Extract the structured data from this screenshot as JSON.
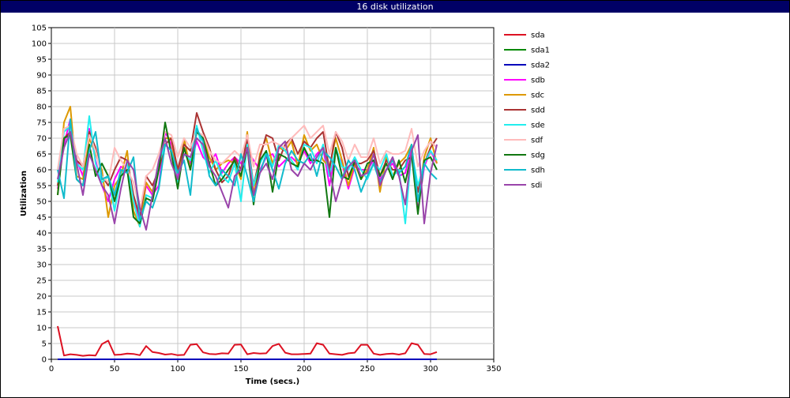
{
  "window": {
    "title": "16 disk utilization"
  },
  "chart_data": {
    "type": "line",
    "title": "16 disk utilization",
    "xlabel": "Time (secs.)",
    "ylabel": "Utilization",
    "xlim": [
      0,
      350
    ],
    "ylim": [
      0,
      105
    ],
    "xticks": [
      0,
      50,
      100,
      150,
      200,
      250,
      300,
      350
    ],
    "yticks": [
      0,
      5,
      10,
      15,
      20,
      25,
      30,
      35,
      40,
      45,
      50,
      55,
      60,
      65,
      70,
      75,
      80,
      85,
      90,
      95,
      100,
      105
    ],
    "grid": true,
    "legend_position": "right",
    "x": [
      5,
      10,
      15,
      20,
      25,
      30,
      35,
      40,
      45,
      50,
      55,
      60,
      65,
      70,
      75,
      80,
      85,
      90,
      95,
      100,
      105,
      110,
      115,
      120,
      125,
      130,
      135,
      140,
      145,
      150,
      155,
      160,
      165,
      170,
      175,
      180,
      185,
      190,
      195,
      200,
      205,
      210,
      215,
      220,
      225,
      230,
      235,
      240,
      245,
      250,
      255,
      260,
      265,
      270,
      275,
      280,
      285,
      290,
      295,
      300,
      305
    ],
    "series": [
      {
        "name": "sda",
        "color": "#dd1122",
        "values": [
          10.5,
          1.2,
          1.6,
          1.4,
          1.1,
          1.3,
          1.2,
          4.8,
          5.9,
          1.4,
          1.5,
          1.8,
          1.7,
          1.3,
          4.2,
          2.3,
          2.0,
          1.5,
          1.7,
          1.3,
          1.4,
          4.6,
          4.8,
          2.2,
          1.7,
          1.6,
          1.9,
          1.8,
          4.6,
          4.7,
          1.6,
          2.0,
          1.8,
          1.9,
          4.2,
          4.9,
          2.1,
          1.6,
          1.6,
          1.7,
          1.8,
          5.1,
          4.6,
          1.8,
          1.6,
          1.4,
          1.9,
          2.1,
          4.6,
          4.6,
          1.8,
          1.4,
          1.7,
          1.8,
          1.5,
          1.9,
          5.1,
          4.6,
          1.7,
          1.6,
          2.3
        ]
      },
      {
        "name": "sda1",
        "color": "#008800",
        "values": [
          0,
          0,
          0,
          0,
          0,
          0,
          0,
          0,
          0,
          0,
          0,
          0,
          0,
          0,
          0,
          0,
          0,
          0,
          0,
          0,
          0,
          0,
          0,
          0,
          0,
          0,
          0,
          0,
          0,
          0,
          0,
          0,
          0,
          0,
          0,
          0,
          0,
          0,
          0,
          0,
          0,
          0,
          0,
          0,
          0,
          0,
          0,
          0,
          0,
          0,
          0,
          0,
          0,
          0,
          0,
          0,
          0,
          0,
          0,
          0,
          0
        ]
      },
      {
        "name": "sda2",
        "color": "#0000bb",
        "values": [
          0,
          0,
          0,
          0,
          0,
          0,
          0,
          0,
          0,
          0,
          0,
          0,
          0,
          0,
          0,
          0,
          0,
          0,
          0,
          0,
          0,
          0,
          0,
          0,
          0,
          0,
          0,
          0,
          0,
          0,
          0,
          0,
          0,
          0,
          0,
          0,
          0,
          0,
          0,
          0,
          0,
          0,
          0,
          0,
          0,
          0,
          0,
          0,
          0,
          0,
          0,
          0,
          0,
          0,
          0,
          0,
          0,
          0,
          0,
          0,
          0
        ]
      },
      {
        "name": "sdb",
        "color": "#ff00ff",
        "values": [
          54,
          68,
          76,
          63,
          58,
          73,
          63,
          55,
          50,
          57,
          61,
          60,
          50,
          44,
          55,
          52,
          55,
          72,
          68,
          58,
          67,
          62,
          69,
          64,
          62,
          65,
          59,
          62,
          64,
          62,
          66,
          63,
          60,
          64,
          65,
          61,
          63,
          64,
          62,
          66,
          62,
          65,
          67,
          55,
          66,
          62,
          54,
          61,
          60,
          60,
          63,
          57,
          60,
          62,
          58,
          59,
          67,
          47,
          61,
          66,
          62
        ]
      },
      {
        "name": "sdc",
        "color": "#dd9900",
        "values": [
          52,
          75,
          80,
          58,
          57,
          70,
          65,
          60,
          45,
          55,
          58,
          66,
          47,
          42,
          56,
          53,
          62,
          70,
          70,
          55,
          70,
          60,
          72,
          70,
          64,
          60,
          62,
          63,
          62,
          57,
          72,
          52,
          65,
          70,
          62,
          67,
          66,
          69,
          61,
          71,
          66,
          68,
          63,
          61,
          70,
          63,
          55,
          62,
          57,
          60,
          67,
          53,
          64,
          58,
          62,
          64,
          68,
          50,
          64,
          70,
          62
        ]
      },
      {
        "name": "sdd",
        "color": "#aa3333",
        "values": [
          55,
          70,
          72,
          63,
          61,
          72,
          67,
          58,
          55,
          60,
          64,
          63,
          52,
          45,
          58,
          55,
          60,
          68,
          70,
          60,
          68,
          66,
          78,
          72,
          67,
          60,
          56,
          58,
          64,
          60,
          70,
          55,
          64,
          71,
          70,
          63,
          68,
          70,
          65,
          69,
          67,
          70,
          72,
          60,
          72,
          67,
          58,
          62,
          62,
          63,
          66,
          58,
          63,
          60,
          60,
          63,
          64,
          53,
          62,
          67,
          70
        ]
      },
      {
        "name": "sde",
        "color": "#22eeee",
        "values": [
          56,
          72,
          74,
          62,
          60,
          77,
          62,
          56,
          58,
          47,
          58,
          62,
          50,
          42,
          52,
          51,
          62,
          68,
          66,
          56,
          65,
          63,
          74,
          66,
          59,
          63,
          58,
          56,
          62,
          50,
          68,
          55,
          62,
          66,
          61,
          68,
          66,
          63,
          60,
          68,
          67,
          62,
          68,
          58,
          67,
          61,
          60,
          64,
          60,
          57,
          62,
          60,
          65,
          58,
          60,
          43,
          66,
          55,
          62,
          66,
          63
        ]
      },
      {
        "name": "sdf",
        "color": "#ffbbbb",
        "values": [
          60,
          73,
          74,
          65,
          61,
          71,
          66,
          58,
          56,
          67,
          63,
          60,
          56,
          47,
          58,
          60,
          65,
          72,
          71,
          64,
          70,
          67,
          72,
          71,
          66,
          63,
          62,
          64,
          66,
          64,
          71,
          61,
          68,
          68,
          69,
          68,
          67,
          70,
          72,
          74,
          70,
          72,
          74,
          65,
          72,
          69,
          63,
          68,
          64,
          64,
          70,
          62,
          66,
          65,
          65,
          66,
          73,
          61,
          66,
          69,
          67
        ]
      },
      {
        "name": "sdg",
        "color": "#117711",
        "values": [
          52,
          70,
          71,
          57,
          55,
          68,
          58,
          62,
          58,
          50,
          58,
          60,
          45,
          43,
          51,
          50,
          60,
          75,
          65,
          54,
          67,
          60,
          72,
          70,
          62,
          55,
          57,
          60,
          63,
          58,
          67,
          49,
          63,
          66,
          53,
          65,
          64,
          62,
          61,
          67,
          63,
          63,
          62,
          45,
          67,
          58,
          57,
          63,
          57,
          62,
          63,
          58,
          62,
          57,
          63,
          56,
          65,
          46,
          63,
          64,
          60
        ]
      },
      {
        "name": "sdh",
        "color": "#11bbcc",
        "values": [
          60,
          51,
          76,
          57,
          55,
          66,
          72,
          57,
          58,
          52,
          60,
          59,
          64,
          44,
          50,
          48,
          54,
          68,
          66,
          59,
          63,
          52,
          73,
          69,
          58,
          55,
          60,
          58,
          55,
          65,
          58,
          50,
          59,
          65,
          60,
          54,
          62,
          66,
          63,
          62,
          65,
          58,
          66,
          64,
          61,
          57,
          63,
          60,
          53,
          58,
          62,
          56,
          60,
          63,
          59,
          61,
          68,
          50,
          62,
          59,
          57
        ]
      },
      {
        "name": "sdi",
        "color": "#9944aa",
        "values": [
          57,
          67,
          72,
          62,
          52,
          65,
          60,
          55,
          52,
          43,
          54,
          63,
          60,
          48,
          41,
          52,
          63,
          70,
          62,
          57,
          65,
          64,
          70,
          68,
          61,
          58,
          53,
          48,
          58,
          60,
          67,
          52,
          59,
          62,
          57,
          67,
          69,
          60,
          58,
          62,
          60,
          64,
          67,
          60,
          50,
          57,
          61,
          63,
          58,
          59,
          65,
          55,
          60,
          64,
          58,
          49,
          66,
          71,
          43,
          59,
          68
        ]
      }
    ]
  }
}
